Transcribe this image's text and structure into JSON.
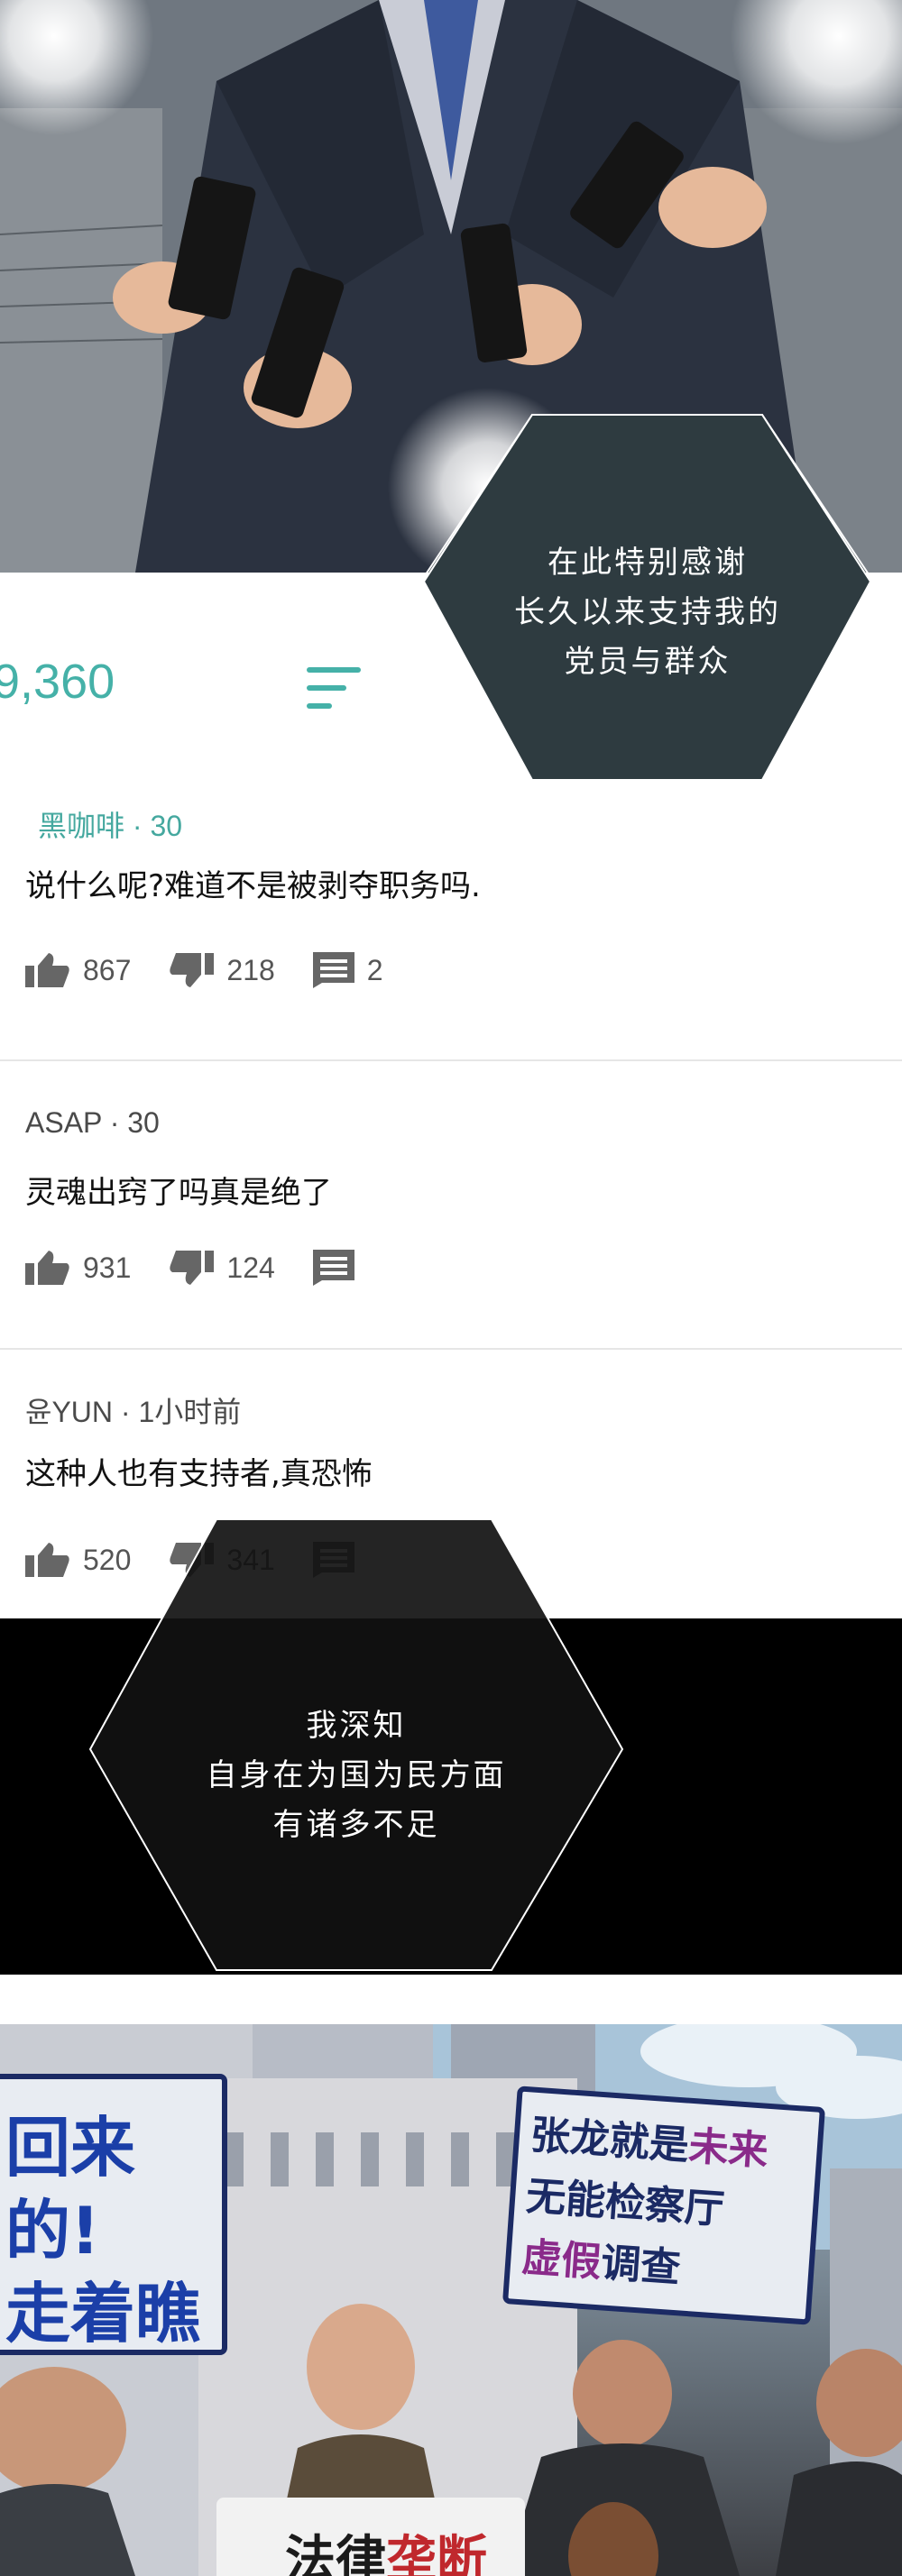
{
  "top_caption": {
    "lines": [
      "在此特别感谢",
      "长久以来支持我的",
      "党员与群众"
    ]
  },
  "comment_header": {
    "count": "9,360",
    "sort_icon": "sort-lines-icon"
  },
  "comments": [
    {
      "author": "黑咖啡",
      "meta": "· 30",
      "text": "说什么呢?难道不是被剥夺职务吗.",
      "likes": "867",
      "dislikes": "218",
      "replies": "2"
    },
    {
      "author": "ASAP",
      "meta": "· 30",
      "text": "灵魂出窍了吗真是绝了",
      "likes": "931",
      "dislikes": "124",
      "replies": ""
    },
    {
      "author": "윤YUN",
      "meta": "· 1小时前",
      "text": "这种人也有支持者,真恐怖",
      "likes": "520",
      "dislikes": "341",
      "replies": ""
    }
  ],
  "middle_caption": {
    "lines": [
      "我深知",
      "自身在为国为民方面",
      "有诸多不足"
    ]
  },
  "protest_signs": {
    "left_lines": [
      "回来的!",
      "走着瞧"
    ],
    "right_lines": [
      "张龙就是未来",
      "无能检察厅",
      "虚假调查"
    ],
    "right_highlight_1": "未来",
    "right_highlight_3": "虚假",
    "bottom": "法律垄断"
  },
  "colors": {
    "teal": "#45b1a8",
    "sign_blue": "#1b3fa8",
    "sign_purple": "#8a2a8a"
  }
}
